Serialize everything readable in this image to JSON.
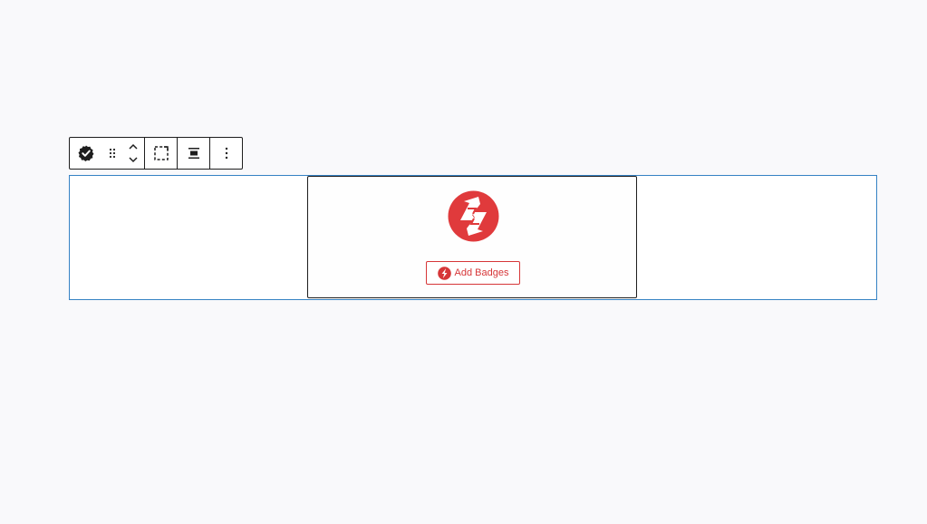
{
  "colors": {
    "accent": "#d63638",
    "selection_border": "#3582c4",
    "toolbar_border": "#1e1e1e",
    "background": "#f9f9fb"
  },
  "toolbar": {
    "block_icon": "badge-check-icon",
    "drag_icon": "drag-handle-icon",
    "move_up_icon": "chevron-up-icon",
    "move_down_icon": "chevron-down-icon",
    "select_parent_icon": "select-parent-icon",
    "align_icon": "align-center-icon",
    "options_icon": "more-vertical-icon"
  },
  "block": {
    "logo_icon": "badges-logo-icon",
    "add_button": {
      "icon": "bolt-circle-icon",
      "label": "Add Badges"
    }
  }
}
